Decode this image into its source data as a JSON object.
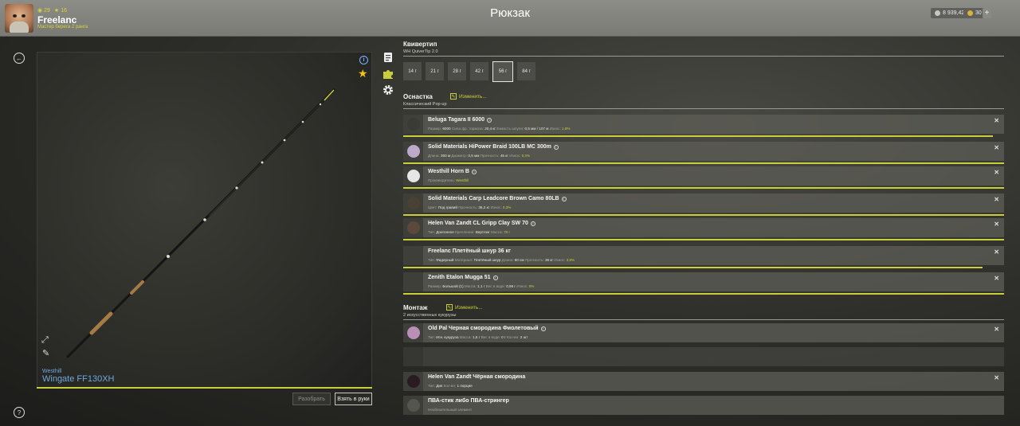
{
  "colors": {
    "accent": "#c9cf3b",
    "link": "#6fa8dc",
    "star": "#f0c419"
  },
  "player": {
    "level": "29",
    "points": "16",
    "name": "Freelanc",
    "rank": "Мастер берега 2 ранга"
  },
  "title": "Рюкзак",
  "currency": {
    "silver": "8 939,42",
    "gold": "30",
    "add": "+"
  },
  "rod": {
    "brand": "Westhill",
    "name": "Wingate FF130XH",
    "icon_info": "info-icon",
    "icon_favorite": "star-icon"
  },
  "buttons": {
    "disassemble": "Разобрать",
    "take": "Взять в руки"
  },
  "tip": {
    "title": "Квивертип",
    "subtitle": "WH QuiverTip 2.0",
    "weights": [
      "14 г",
      "21 г",
      "28 г",
      "42 г",
      "56 г",
      "84 г"
    ],
    "selected": "56 г"
  },
  "rig": {
    "title": "Оснастка",
    "subtitle": "Классический Pop-up",
    "change": "Изменить...",
    "items": [
      {
        "name": "Beluga Tagara II 6000",
        "details": [
          [
            "Размер:",
            "6000"
          ],
          [
            "Сила фр. тормоза:",
            "20,4 кг"
          ],
          [
            "Емкость шпули:",
            "0,5 мм / 107 м"
          ],
          [
            "Износ:",
            "1,8%"
          ]
        ]
      },
      {
        "name": "Solid Materials HiPower Braid 100LB MC 300m",
        "details": [
          [
            "Длина:",
            "300 м"
          ],
          [
            "Диаметр:",
            "0,5 мм"
          ],
          [
            "Прочность:",
            "45 кг"
          ],
          [
            "Износ:",
            "0,3%"
          ]
        ]
      },
      {
        "name": "Westhill Horn B",
        "details": [
          [
            "Производитель:",
            "Westhill"
          ]
        ]
      },
      {
        "name": "Solid Materials Carp Leadcore Brown Camo 80LB",
        "details": [
          [
            "Цвет:",
            "Под гравий"
          ],
          [
            "Прочность:",
            "36,2 кг"
          ],
          [
            "Износ:",
            "0,3%"
          ]
        ]
      },
      {
        "name": "Helen Van Zandt CL Gripp Clay SW 70",
        "details": [
          [
            "Тип:",
            "Донгонное"
          ],
          [
            "Крепление:",
            "Вертлюг"
          ],
          [
            "Масса:",
            "70 г"
          ]
        ]
      },
      {
        "name": "Freelanc Плетёный шнур 36 кг",
        "details": [
          [
            "Тип:",
            "Фидерный"
          ],
          [
            "Материал:",
            "Плетёный шнур"
          ],
          [
            "Длина:",
            "60 см"
          ],
          [
            "Прочность:",
            "36 кг"
          ],
          [
            "Износ:",
            "3,8%"
          ]
        ]
      },
      {
        "name": "Zenith Etalon Mugga 51",
        "details": [
          [
            "Размер:",
            "Большой (1)"
          ],
          [
            "Масса:",
            "1,1 г"
          ],
          [
            "Вес в воде:",
            "0,96 г"
          ],
          [
            "Износ:",
            "0%"
          ]
        ]
      }
    ]
  },
  "mount": {
    "title": "Монтаж",
    "subtitle": "2 искусственных кукурузы",
    "change": "Изменить...",
    "items": [
      {
        "name": "Old Pal Черная смородина Фиолетовый",
        "details": [
          [
            "Тип:",
            "Иск. кукуруза"
          ],
          [
            "Масса:",
            "1,5 г"
          ],
          [
            "Вес в воде:",
            "0 г"
          ],
          [
            "Кол-во:",
            "2 шт"
          ]
        ]
      },
      {
        "name": "Helen Van Zandt Чёрная смородина",
        "details": [
          [
            "Тип:",
            "Дип"
          ],
          [
            "Кол-во:",
            "1 порция"
          ]
        ]
      },
      {
        "name": "ПВА-стик либо ПВА-стрингер",
        "details": [
          [
            "Необязательный элемент",
            ""
          ]
        ]
      }
    ]
  }
}
